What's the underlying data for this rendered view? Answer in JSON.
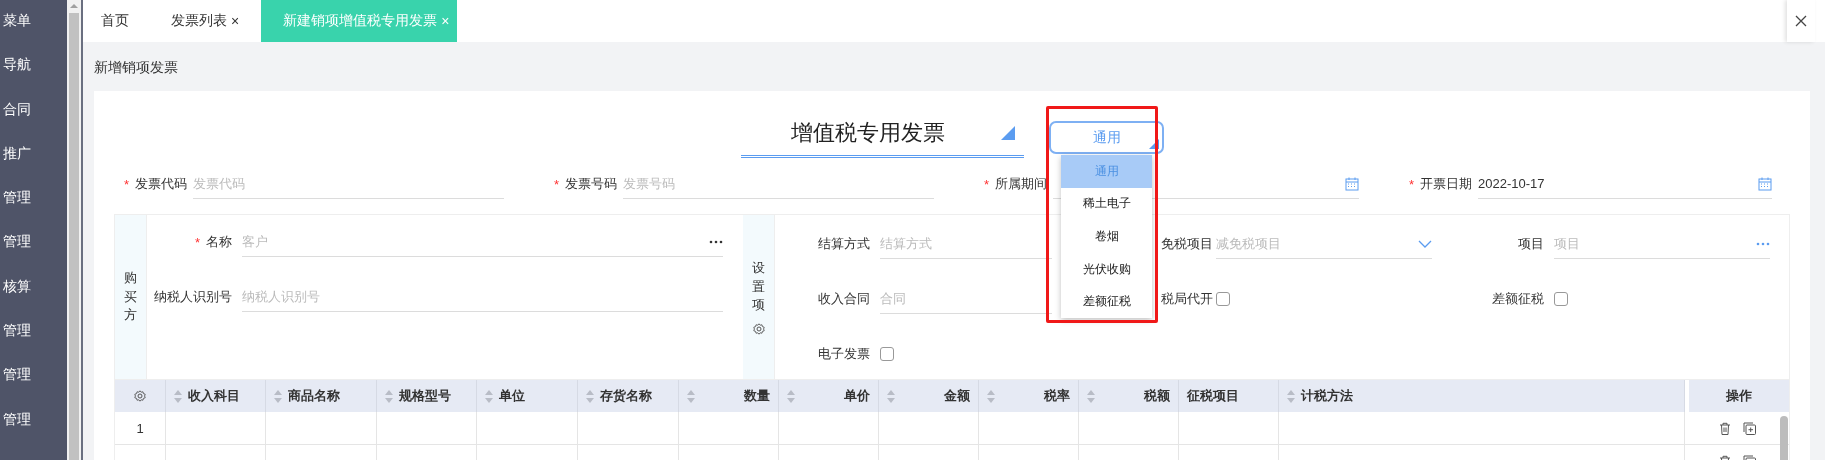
{
  "sidebar": {
    "items": [
      {
        "label": "菜单"
      },
      {
        "label": "导航"
      },
      {
        "label": "合同"
      },
      {
        "label": "推广"
      },
      {
        "label": "管理"
      },
      {
        "label": "管理"
      },
      {
        "label": "核算"
      },
      {
        "label": "管理"
      },
      {
        "label": "管理"
      },
      {
        "label": "管理"
      }
    ]
  },
  "tabs": [
    {
      "label": "首页",
      "selected": false
    },
    {
      "label": "发票列表",
      "close": "×",
      "selected": false
    },
    {
      "label": "新建销项增值税专用发票",
      "close": "×",
      "selected": true
    }
  ],
  "page_title": "新增销项发票",
  "invoice_type": {
    "value": "增值税专用发票"
  },
  "category_select": {
    "value": "通用",
    "expanded": true,
    "options": [
      {
        "label": "通用",
        "selected": true
      },
      {
        "label": "稀土电子",
        "selected": false
      },
      {
        "label": "卷烟",
        "selected": false
      },
      {
        "label": "光伏收购",
        "selected": false
      },
      {
        "label": "差额征税",
        "selected": false
      }
    ]
  },
  "header_fields": [
    {
      "label": "发票代码",
      "required_mark": "*",
      "kind": "text",
      "placeholder": "发票代码"
    },
    {
      "label": "发票号码",
      "required_mark": "*",
      "kind": "text",
      "placeholder": "发票号码"
    },
    {
      "label": "所属期间",
      "required_mark": "*",
      "kind": "date"
    },
    {
      "label": "开票日期",
      "required_mark": "*",
      "kind": "date",
      "value": "2022-10-17"
    }
  ],
  "buyer": {
    "title": "购买方",
    "fields": [
      {
        "label": "名称",
        "required_mark": "*",
        "kind": "lookup",
        "placeholder": "客户"
      },
      {
        "label": "纳税人识别号",
        "kind": "text",
        "placeholder": "纳税人识别号"
      }
    ]
  },
  "settings": {
    "title": "设置项",
    "fields": [
      {
        "label": "结算方式",
        "kind": "text",
        "placeholder": "结算方式"
      },
      {
        "label": "免税项目",
        "kind": "select",
        "placeholder": "减免税项目"
      },
      {
        "label": "项目",
        "kind": "lookup",
        "placeholder": "项目"
      },
      {
        "label": "收入合同",
        "kind": "text",
        "placeholder": "合同"
      },
      {
        "label": "税局代开",
        "kind": "checkbox",
        "checked": false
      },
      {
        "label": "差额征税",
        "kind": "checkbox",
        "checked": false
      },
      {
        "label": "电子发票",
        "kind": "checkbox",
        "checked": false
      }
    ]
  },
  "table": {
    "columns": [
      {
        "label": "收入科目",
        "kind": "text"
      },
      {
        "label": "商品名称",
        "kind": "text"
      },
      {
        "label": "规格型号",
        "kind": "text"
      },
      {
        "label": "单位",
        "kind": "text"
      },
      {
        "label": "存货名称",
        "kind": "text"
      },
      {
        "label": "数量",
        "kind": "number"
      },
      {
        "label": "单价",
        "kind": "number"
      },
      {
        "label": "金额",
        "kind": "number"
      },
      {
        "label": "税率",
        "kind": "number"
      },
      {
        "label": "税额",
        "kind": "number"
      },
      {
        "label": "征税项目",
        "kind": "plain"
      },
      {
        "label": "计税方法",
        "kind": "text"
      },
      {
        "label": "操作",
        "kind": "actions"
      }
    ],
    "rows": [
      {
        "index": "1"
      },
      {}
    ]
  }
}
